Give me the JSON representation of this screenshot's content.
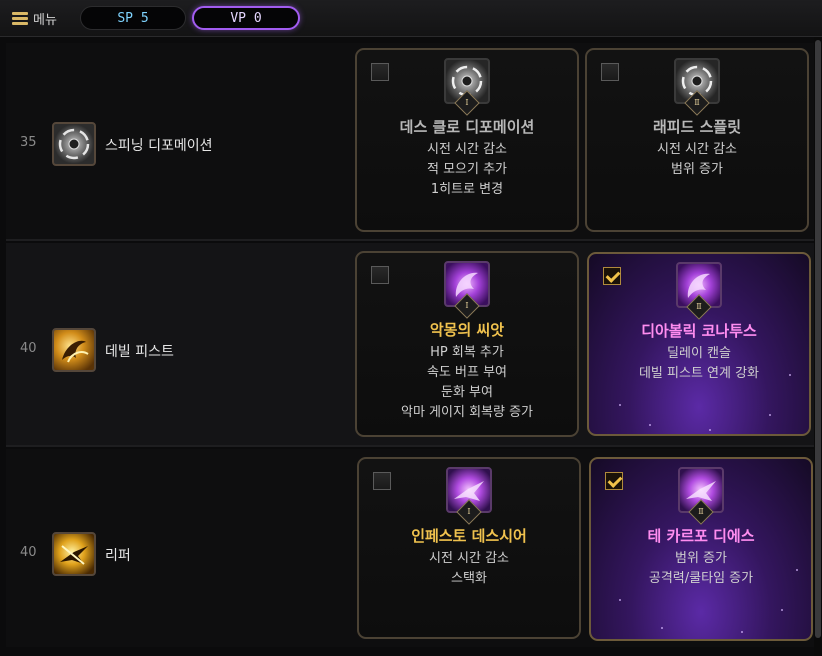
{
  "topbar": {
    "menu_label": "메뉴",
    "sp_label": "SP 5",
    "vp_label": "VP 0"
  },
  "rows": [
    {
      "level": "35",
      "skill_name": "스피닝 디포메이션",
      "skill_icon": "vortex-icon",
      "talents": [
        {
          "roman": "Ⅰ",
          "name": "데스 클로 디포메이션",
          "lines": [
            "시전 시간 감소",
            "적 모으기 추가",
            "1히트로 변경"
          ],
          "checked": false,
          "selected": false
        },
        {
          "roman": "Ⅱ",
          "name": "래피드 스플릿",
          "lines": [
            "시전 시간 감소",
            "범위 증가"
          ],
          "checked": false,
          "selected": false
        }
      ]
    },
    {
      "level": "40",
      "skill_name": "데빌 피스트",
      "skill_icon": "devil-fist-icon",
      "talents": [
        {
          "roman": "Ⅰ",
          "name": "악몽의 씨앗",
          "lines": [
            "HP 회복 추가",
            "속도 버프 부여",
            "둔화 부여",
            "악마 게이지 회복량 증가"
          ],
          "checked": false,
          "selected": false
        },
        {
          "roman": "Ⅱ",
          "name": "디아볼릭 코나투스",
          "lines": [
            "딜레이 캔슬",
            "데빌 피스트 연계 강화"
          ],
          "checked": true,
          "selected": true
        }
      ]
    },
    {
      "level": "40",
      "skill_name": "리퍼",
      "skill_icon": "reaper-icon",
      "talents": [
        {
          "roman": "Ⅰ",
          "name": "인페스토 데스시어",
          "lines": [
            "시전 시간 감소",
            "스택화"
          ],
          "checked": false,
          "selected": false
        },
        {
          "roman": "Ⅱ",
          "name": "테 카르포 디에스",
          "lines": [
            "범위 증가",
            "공격력/쿨타임 증가"
          ],
          "checked": true,
          "selected": true
        }
      ]
    }
  ],
  "colors": {
    "gold": "#f0c24e",
    "pink": "#ff8df0",
    "vp_border": "#a25cf0",
    "sp_text": "#7fd4ff"
  }
}
